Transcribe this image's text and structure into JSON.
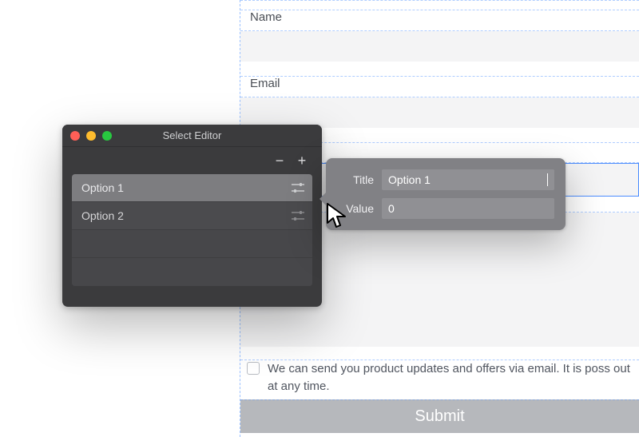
{
  "form": {
    "name_label": "Name",
    "email_label": "Email",
    "consent_text": "We can send you product updates and offers via email. It is poss      out at any time.",
    "submit_label": "Submit"
  },
  "select_editor": {
    "window_title": "Select Editor",
    "minus": "−",
    "plus": "+",
    "options": [
      {
        "label": "Option 1"
      },
      {
        "label": "Option 2"
      }
    ]
  },
  "popover": {
    "title_label": "Title",
    "title_value": "Option 1",
    "value_label": "Value",
    "value_value": "0"
  }
}
